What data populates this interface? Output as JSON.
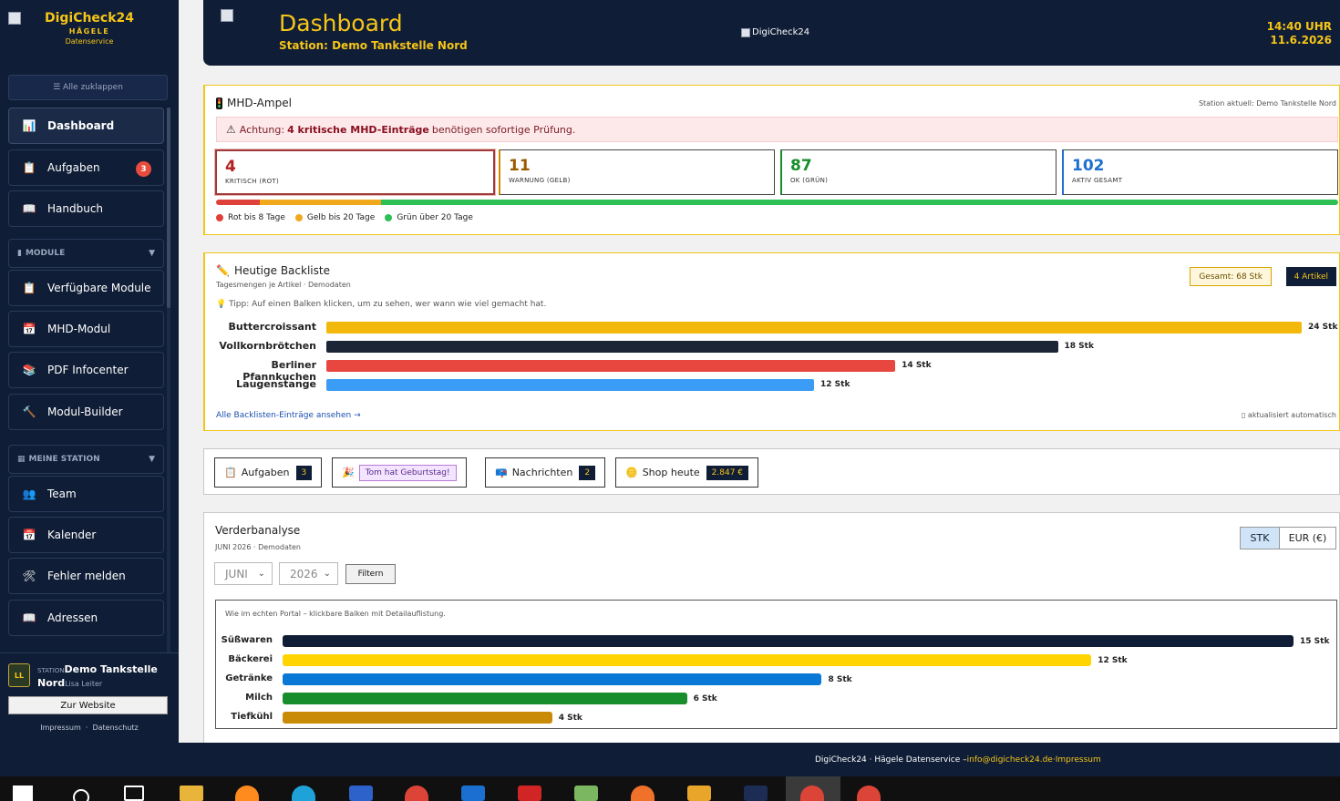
{
  "brand": {
    "name": "DigiCheck24",
    "line2": "HÄGELE",
    "line3": "Datenservice"
  },
  "sidebar": {
    "collapse_label": "☰ Alle zuklappen",
    "items": [
      {
        "label": "Dashboard",
        "icon": "chart-icon",
        "glyph": "📊"
      },
      {
        "label": "Aufgaben",
        "icon": "clipboard-icon",
        "glyph": "📋",
        "badge": "3"
      },
      {
        "label": "Handbuch",
        "icon": "book-icon",
        "glyph": "📖"
      }
    ],
    "section_modules": {
      "label": "MODULE",
      "glyph": "▮"
    },
    "module_items": [
      {
        "label": "Verfügbare Module",
        "icon": "clipboard-icon",
        "glyph": "📋"
      },
      {
        "label": "MHD-Modul",
        "icon": "calendar-icon",
        "glyph": "📅"
      },
      {
        "label": "PDF Infocenter",
        "icon": "books-icon",
        "glyph": "📚"
      },
      {
        "label": "Modul-Builder",
        "icon": "hammer-icon",
        "glyph": "🔨"
      }
    ],
    "section_station": {
      "label": "MEINE STATION",
      "glyph": "▦"
    },
    "station_items": [
      {
        "label": "Team",
        "icon": "people-icon",
        "glyph": "👥"
      },
      {
        "label": "Kalender",
        "icon": "calendar-icon",
        "glyph": "📅"
      },
      {
        "label": "Fehler melden",
        "icon": "tools-icon",
        "glyph": "🛠"
      },
      {
        "label": "Adressen",
        "icon": "book-icon",
        "glyph": "📖"
      }
    ],
    "user": {
      "initials": "LL",
      "station_prefix": "STATION",
      "station_part1": "Demo Tankstelle",
      "station_part2": "Nord",
      "role": "Lisa Leiter",
      "website_button": "Zur Website",
      "impressum": "Impressum",
      "separator": "·",
      "datenschutz": "Datenschutz"
    }
  },
  "header": {
    "title": "Dashboard",
    "station": "Station: Demo Tankstelle Nord",
    "center_logo_alt": "DigiCheck24",
    "time": "14:40 UHR",
    "date": "11.6.2026"
  },
  "mhd": {
    "title": "MHD-Ampel",
    "station_current": "Station aktuell: Demo Tankstelle Nord",
    "alert_prefix": "Achtung:",
    "alert_bold": "4 kritische MHD-Einträge",
    "alert_suffix": "benötigen sofortige Prüfung.",
    "stats": [
      {
        "value": "4",
        "label": "KRITISCH (ROT)"
      },
      {
        "value": "11",
        "label": "WARNUNG (GELB)"
      },
      {
        "value": "87",
        "label": "OK (GRÜN)"
      },
      {
        "value": "102",
        "label": "AKTIV GESAMT"
      }
    ],
    "legend": [
      {
        "label": "Rot bis 8 Tage",
        "color": "#e0403a"
      },
      {
        "label": "Gelb bis 20 Tage",
        "color": "#f2a81d"
      },
      {
        "label": "Grün über 20 Tage",
        "color": "#2ebf55"
      }
    ]
  },
  "backliste": {
    "title": "Heutige Backliste",
    "subtitle": "Tagesmengen je Artikel · Demodaten",
    "tip": "💡 Tipp: Auf einen Balken klicken, um zu sehen, wer wann wie viel gemacht hat.",
    "total": "Gesamt: 68 Stk",
    "articles": "4 Artikel",
    "link": "Alle Backlisten-Einträge ansehen →",
    "auto": "▯ aktualisiert automatisch",
    "unit": "Stk"
  },
  "quick": {
    "aufgaben_label": "Aufgaben",
    "aufgaben_count": "3",
    "birthday": "Tom hat Geburtstag!",
    "nachrichten_label": "Nachrichten",
    "nachrichten_count": "2",
    "shop_label": "Shop heute",
    "shop_value": "2.847 €"
  },
  "verderb": {
    "title": "Verderbanalyse",
    "subtitle": "JUNI 2026 · Demodaten",
    "toggle_stk": "STK",
    "toggle_eur": "EUR (€)",
    "month": "JUNI",
    "year": "2026",
    "filter": "Filtern",
    "note": "Wie im echten Portal – klickbare Balken mit Detailauflistung.",
    "unit": "Stk"
  },
  "chart_data": [
    {
      "type": "bar",
      "orientation": "horizontal",
      "title": "Heutige Backliste",
      "categories": [
        "Buttercroissant",
        "Vollkornbrötchen",
        "Berliner Pfannkuchen",
        "Laugenstange"
      ],
      "values": [
        24,
        18,
        14,
        12
      ],
      "colors": [
        "#f2b90c",
        "#1b2536",
        "#e8473f",
        "#3b9cf5"
      ],
      "value_suffix": "Stk"
    },
    {
      "type": "bar",
      "orientation": "horizontal",
      "title": "Verderbanalyse",
      "categories": [
        "Süßwaren",
        "Bäckerei",
        "Getränke",
        "Milch",
        "Tiefkühl"
      ],
      "values": [
        15,
        12,
        8,
        6,
        4
      ],
      "colors": [
        "#0f1d36",
        "#ffd400",
        "#0a78d6",
        "#178d2b",
        "#c98b05"
      ],
      "value_suffix": "Stk"
    },
    {
      "type": "bar",
      "orientation": "stacked-horizontal",
      "title": "MHD-Ampel",
      "categories": [
        "Rot",
        "Gelb",
        "Grün"
      ],
      "values": [
        4,
        11,
        87
      ],
      "colors": [
        "#e0403a",
        "#f2a81d",
        "#2ebf55"
      ]
    }
  ],
  "footer": {
    "text": "DigiCheck24 · Hägele Datenservice –",
    "mail": "info@digicheck24.de",
    "impressum": "·Impressum"
  }
}
